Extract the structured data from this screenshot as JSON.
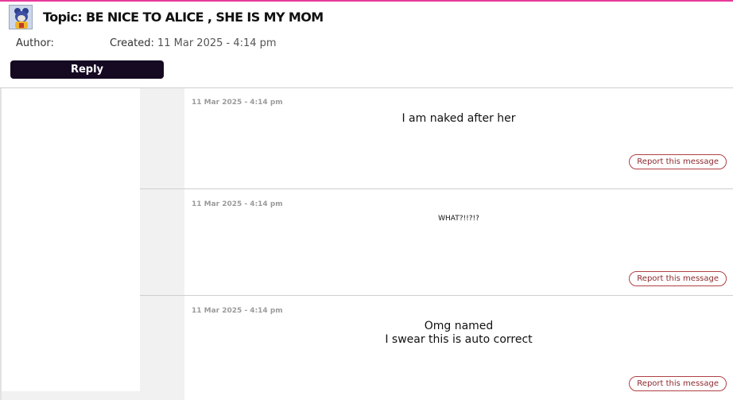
{
  "topic": {
    "title": "Topic: BE NICE TO ALICE , SHE IS MY MOM",
    "author_label": "Author:",
    "created_label": "Created:",
    "created_value": "11 Mar 2025 - 4:14 pm",
    "reply_label": "Reply"
  },
  "posts": [
    {
      "date": "11 Mar 2025 - 4:14 pm",
      "lines": [
        "I am naked after her"
      ],
      "report_label": "Report this message"
    },
    {
      "date": "11 Mar 2025 - 4:14 pm",
      "lines": [
        "WHAT?!!?!?"
      ],
      "report_label": "Report this message"
    },
    {
      "date": "11 Mar 2025 - 4:14 pm",
      "lines": [
        "Omg named",
        "I swear this is auto correct"
      ],
      "report_label": "Report this message"
    }
  ],
  "colors": {
    "accent_topline": "#e83a9b",
    "reply_button": "#150a22",
    "report_border": "#b04045"
  },
  "icons": {
    "avatar": "cartoon-character-avatar"
  }
}
